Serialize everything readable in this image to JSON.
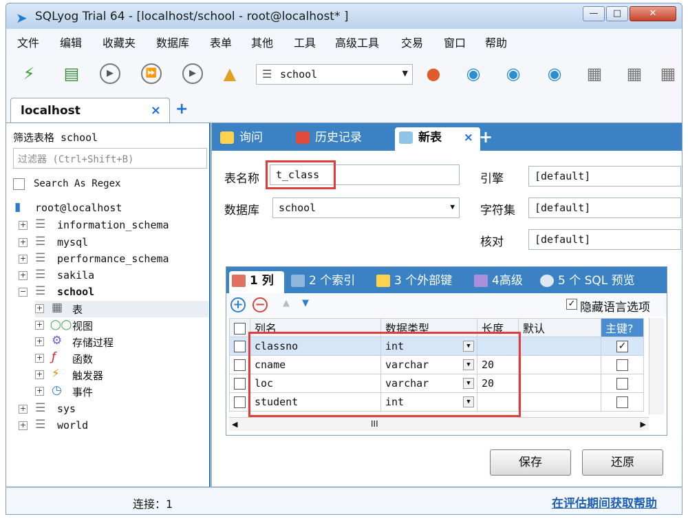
{
  "window": {
    "title": "SQLyog Trial 64 - [localhost/school - root@localhost* ]"
  },
  "menu": [
    "文件",
    "编辑",
    "收藏夹",
    "数据库",
    "表单",
    "其他",
    "工具",
    "高级工具",
    "交易",
    "窗口",
    "帮助"
  ],
  "toolbar": {
    "db_select": "school"
  },
  "conn_tab": {
    "label": "localhost",
    "close": "×",
    "add": "+"
  },
  "left": {
    "filter_title": "筛选表格 school",
    "filter_placeholder": "过滤器 (Ctrl+Shift+B)",
    "regex_label": "Search As Regex",
    "tree": [
      {
        "label": "root@localhost",
        "expander": "",
        "icon": "server-icon"
      },
      {
        "label": "information_schema",
        "expander": "+",
        "icon": "database-icon"
      },
      {
        "label": "mysql",
        "expander": "+",
        "icon": "database-icon"
      },
      {
        "label": "performance_schema",
        "expander": "+",
        "icon": "database-icon"
      },
      {
        "label": "sakila",
        "expander": "+",
        "icon": "database-icon"
      },
      {
        "label": "school",
        "expander": "−",
        "icon": "database-icon"
      },
      {
        "label": "表",
        "expander": "+",
        "icon": "table-icon"
      },
      {
        "label": "视图",
        "expander": "+",
        "icon": "view-icon"
      },
      {
        "label": "存储过程",
        "expander": "+",
        "icon": "procedure-icon"
      },
      {
        "label": "函数",
        "expander": "+",
        "icon": "function-icon"
      },
      {
        "label": "触发器",
        "expander": "+",
        "icon": "trigger-icon"
      },
      {
        "label": "事件",
        "expander": "+",
        "icon": "event-icon"
      },
      {
        "label": "sys",
        "expander": "+",
        "icon": "database-icon"
      },
      {
        "label": "world",
        "expander": "+",
        "icon": "database-icon"
      }
    ]
  },
  "subtabs": {
    "query": "询问",
    "history": "历史记录",
    "new_table": "新表",
    "close": "×",
    "add": "+"
  },
  "form": {
    "table_name_label": "表名称",
    "table_name_value": "t_class",
    "database_label": "数据库",
    "database_value": "school",
    "engine_label": "引擎",
    "engine_value": "[default]",
    "charset_label": "字符集",
    "charset_value": "[default]",
    "collation_label": "核对",
    "collation_value": "[default]"
  },
  "grid_tabs": {
    "columns": "1 列",
    "indexes": "2 个索引",
    "foreign_keys": "3 个外部键",
    "advanced": "4高级",
    "sql_preview": "5 个 SQL 预览"
  },
  "grid_tools": {
    "hide_lang_label": "隐藏语言选项",
    "hide_lang_checked": "✓"
  },
  "columns_table": {
    "headers": {
      "name": "列名",
      "type": "数据类型",
      "length": "长度",
      "default": "默认",
      "pk": "主键?"
    },
    "rows": [
      {
        "name": "classno",
        "type": "int",
        "length": "",
        "default": "",
        "pk": "✓"
      },
      {
        "name": "cname",
        "type": "varchar",
        "length": "20",
        "default": "",
        "pk": ""
      },
      {
        "name": "loc",
        "type": "varchar",
        "length": "20",
        "default": "",
        "pk": ""
      },
      {
        "name": "student",
        "type": "int",
        "length": "",
        "default": "",
        "pk": ""
      }
    ],
    "hscroll_label": "III"
  },
  "buttons": {
    "save": "保存",
    "revert": "还原"
  },
  "status": {
    "connections": "连接：1",
    "help": "在评估期间获取帮助"
  },
  "colors": {
    "accent": "#3b82c4",
    "highlight": "#e03c3c",
    "link": "#1d5fb5"
  }
}
